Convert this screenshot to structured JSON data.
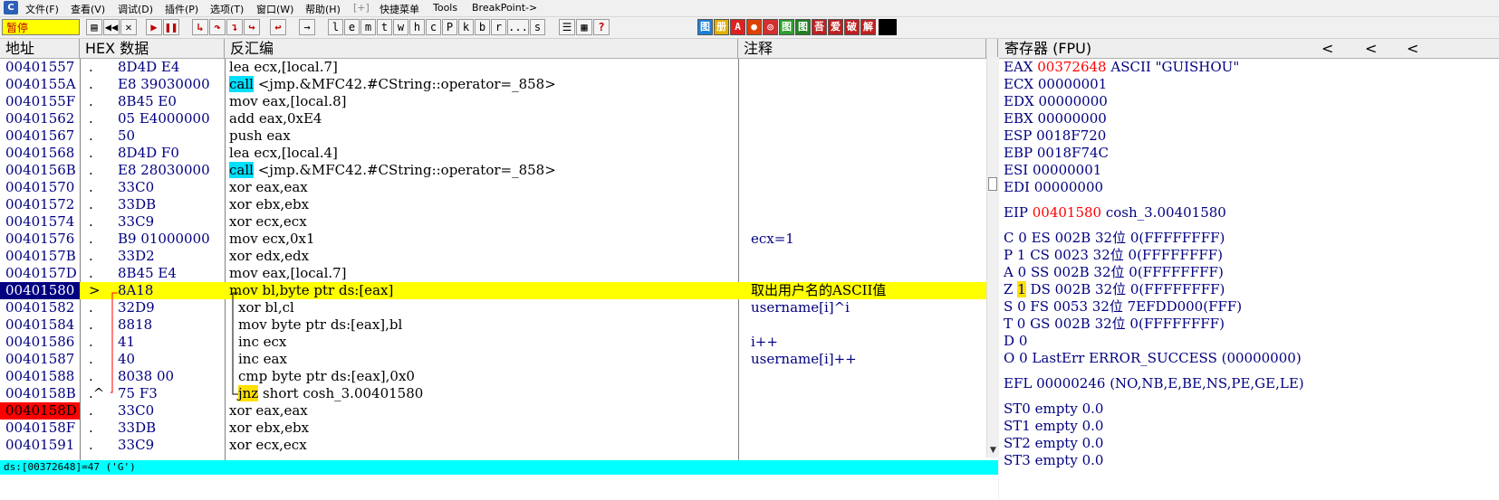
{
  "menu": {
    "app_icon": "C",
    "items": [
      "文件(F)",
      "查看(V)",
      "调试(D)",
      "插件(P)",
      "选项(T)",
      "窗口(W)",
      "帮助(H)",
      "[+]",
      "快捷菜单",
      "Tools",
      "BreakPoint->"
    ]
  },
  "toolbar": {
    "status": "暂停",
    "buttons": [
      "l",
      "e",
      "m",
      "t",
      "w",
      "h",
      "c",
      "P",
      "k",
      "b",
      "r",
      "...",
      "s"
    ],
    "plugin_icons": [
      "图",
      "册",
      "A",
      "●",
      "◎",
      "图",
      "图",
      "吾",
      "爱",
      "破",
      "解"
    ]
  },
  "disasm": {
    "headers": {
      "addr": "地址",
      "hex": "HEX 数据",
      "dis": "反汇编",
      "cmt": "注释"
    },
    "rows": [
      {
        "addr": "00401557",
        "mark": ".",
        "hex": "8D4D E4",
        "pre": "lea ecx,[local.7]",
        "kw": "",
        "post": "",
        "cmt": ""
      },
      {
        "addr": "0040155A",
        "mark": ".",
        "hex": "E8 39030000",
        "pre": "",
        "kw": "call",
        "post": " <jmp.&MFC42.#CString::operator=_858>",
        "cmt": ""
      },
      {
        "addr": "0040155F",
        "mark": ".",
        "hex": "8B45 E0",
        "pre": "mov eax,[local.8]",
        "kw": "",
        "post": "",
        "cmt": ""
      },
      {
        "addr": "00401562",
        "mark": ".",
        "hex": "05 E4000000",
        "pre": "add eax,0xE4",
        "kw": "",
        "post": "",
        "cmt": ""
      },
      {
        "addr": "00401567",
        "mark": ".",
        "hex": "50",
        "pre": "push eax",
        "kw": "",
        "post": "",
        "cmt": ""
      },
      {
        "addr": "00401568",
        "mark": ".",
        "hex": "8D4D F0",
        "pre": "lea ecx,[local.4]",
        "kw": "",
        "post": "",
        "cmt": ""
      },
      {
        "addr": "0040156B",
        "mark": ".",
        "hex": "E8 28030000",
        "pre": "",
        "kw": "call",
        "post": " <jmp.&MFC42.#CString::operator=_858>",
        "cmt": ""
      },
      {
        "addr": "00401570",
        "mark": ".",
        "hex": "33C0",
        "pre": "xor eax,eax",
        "kw": "",
        "post": "",
        "cmt": ""
      },
      {
        "addr": "00401572",
        "mark": ".",
        "hex": "33DB",
        "pre": "xor ebx,ebx",
        "kw": "",
        "post": "",
        "cmt": ""
      },
      {
        "addr": "00401574",
        "mark": ".",
        "hex": "33C9",
        "pre": "xor ecx,ecx",
        "kw": "",
        "post": "",
        "cmt": ""
      },
      {
        "addr": "00401576",
        "mark": ".",
        "hex": "B9 01000000",
        "pre": "mov ecx,0x1",
        "kw": "",
        "post": "",
        "cmt": "ecx=1"
      },
      {
        "addr": "0040157B",
        "mark": ".",
        "hex": "33D2",
        "pre": "xor edx,edx",
        "kw": "",
        "post": "",
        "cmt": ""
      },
      {
        "addr": "0040157D",
        "mark": ".",
        "hex": "8B45 E4",
        "pre": "mov eax,[local.7]",
        "kw": "",
        "post": "",
        "cmt": ""
      },
      {
        "addr": "00401580",
        "mark": ">",
        "hex": "8A18",
        "pre": "mov bl,byte ptr ds:[eax]",
        "kw": "",
        "post": "",
        "cmt": "取出用户名的ASCII值"
      },
      {
        "addr": "00401582",
        "mark": ".",
        "hex": "32D9",
        "pre": "xor bl,cl",
        "kw": "",
        "post": "",
        "cmt": "username[i]^i"
      },
      {
        "addr": "00401584",
        "mark": ".",
        "hex": "8818",
        "pre": "mov byte ptr ds:[eax],bl",
        "kw": "",
        "post": "",
        "cmt": ""
      },
      {
        "addr": "00401586",
        "mark": ".",
        "hex": "41",
        "pre": "inc ecx",
        "kw": "",
        "post": "",
        "cmt": "i++"
      },
      {
        "addr": "00401587",
        "mark": ".",
        "hex": "40",
        "pre": "inc eax",
        "kw": "",
        "post": "",
        "cmt": "username[i]++"
      },
      {
        "addr": "00401588",
        "mark": ".",
        "hex": "8038 00",
        "pre": "cmp byte ptr ds:[eax],0x0",
        "kw": "",
        "post": "",
        "cmt": ""
      },
      {
        "addr": "0040158B",
        "mark": ".^",
        "hex": "75 F3",
        "pre": "",
        "kw": "jnz",
        "post": " short cosh_3.00401580",
        "cmt": ""
      },
      {
        "addr": "0040158D",
        "mark": ".",
        "hex": "33C0",
        "pre": "xor eax,eax",
        "kw": "",
        "post": "",
        "cmt": ""
      },
      {
        "addr": "0040158F",
        "mark": ".",
        "hex": "33DB",
        "pre": "xor ebx,ebx",
        "kw": "",
        "post": "",
        "cmt": ""
      },
      {
        "addr": "00401591",
        "mark": ".",
        "hex": "33C9",
        "pre": "xor ecx,ecx",
        "kw": "",
        "post": "",
        "cmt": ""
      }
    ],
    "info": "ds:[00372648]=47 ('G')"
  },
  "registers": {
    "header": "寄存器 (FPU)",
    "arrows": [
      "<",
      "<",
      "<"
    ],
    "gp": [
      {
        "name": "EAX",
        "val": "00372648",
        "extra": " ASCII \"GUISHOU\"",
        "changed": true
      },
      {
        "name": "ECX",
        "val": "00000001",
        "extra": "",
        "changed": false
      },
      {
        "name": "EDX",
        "val": "00000000",
        "extra": "",
        "changed": false
      },
      {
        "name": "EBX",
        "val": "00000000",
        "extra": "",
        "changed": false
      },
      {
        "name": "ESP",
        "val": "0018F720",
        "extra": "",
        "changed": false
      },
      {
        "name": "EBP",
        "val": "0018F74C",
        "extra": "",
        "changed": false
      },
      {
        "name": "ESI",
        "val": "00000001",
        "extra": "",
        "changed": false
      },
      {
        "name": "EDI",
        "val": "00000000",
        "extra": "",
        "changed": false
      }
    ],
    "eip": {
      "name": "EIP",
      "val": "00401580",
      "extra": " cosh_3.00401580"
    },
    "flags": [
      {
        "f": "C",
        "v": "0",
        "seg": "ES 002B 32位 0(FFFFFFFF)"
      },
      {
        "f": "P",
        "v": "1",
        "seg": "CS 0023 32位 0(FFFFFFFF)"
      },
      {
        "f": "A",
        "v": "0",
        "seg": "SS 002B 32位 0(FFFFFFFF)"
      },
      {
        "f": "Z",
        "v": "1",
        "seg": "DS 002B 32位 0(FFFFFFFF)"
      },
      {
        "f": "S",
        "v": "0",
        "seg": "FS 0053 32位 7EFDD000(FFF)"
      },
      {
        "f": "T",
        "v": "0",
        "seg": "GS 002B 32位 0(FFFFFFFF)"
      },
      {
        "f": "D",
        "v": "0",
        "seg": ""
      },
      {
        "f": "O",
        "v": "0",
        "seg": "LastErr ERROR_SUCCESS (00000000)"
      }
    ],
    "efl": "EFL 00000246 (NO,NB,E,BE,NS,PE,GE,LE)",
    "fpu": [
      "ST0 empty 0.0",
      "ST1 empty 0.0",
      "ST2 empty 0.0",
      "ST3 empty 0.0"
    ]
  },
  "colors": {
    "eip_row": "#ffff00",
    "selected_addr": "#000080",
    "breakpoint_addr": "#ff0000",
    "call_highlight": "#00e0ff",
    "jump_highlight": "#ffe000"
  }
}
